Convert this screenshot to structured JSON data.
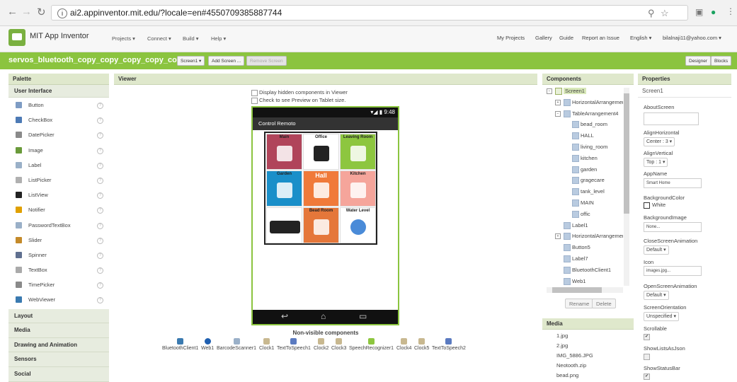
{
  "browser": {
    "url": "ai2.appinventor.mit.edu/?locale=en#4550709385887744"
  },
  "topbar": {
    "brand": "MIT App Inventor",
    "menus": [
      "Projects ▾",
      "Connect ▾",
      "Build ▾",
      "Help ▾"
    ],
    "right_links": [
      "My Projects",
      "Gallery",
      "Guide",
      "Report an Issue",
      "English ▾",
      "bilalnaji11@yahoo.com ▾"
    ]
  },
  "projectbar": {
    "name": "servos_bluetooth_copy_copy_copy_copy_copy",
    "screen_select": "Screen1 ▾",
    "add_screen": "Add Screen ...",
    "remove_screen": "Remove Screen",
    "designer": "Designer",
    "blocks": "Blocks"
  },
  "palette": {
    "title": "Palette",
    "category_open": "User Interface",
    "items": [
      "Button",
      "CheckBox",
      "DatePicker",
      "Image",
      "Label",
      "ListPicker",
      "ListView",
      "Notifier",
      "PasswordTextBox",
      "Slider",
      "Spinner",
      "TextBox",
      "TimePicker",
      "WebViewer"
    ],
    "other_categories": [
      "Layout",
      "Media",
      "Drawing and Animation",
      "Sensors",
      "Social"
    ]
  },
  "viewer": {
    "title": "Viewer",
    "check_hidden": "Display hidden components in Viewer",
    "check_tablet": "Check to see Preview on Tablet size.",
    "status_time": "9:48",
    "app_title": "Control Remoto",
    "tiles": [
      {
        "label": "Main",
        "color": "#b0445a"
      },
      {
        "label": "Office",
        "color": "#ffffff"
      },
      {
        "label": "Leaving Room",
        "color": "#8dc63f"
      },
      {
        "label": "Garden",
        "color": "#1a8fc9"
      },
      {
        "label": "Hall",
        "color": "#f07a3a"
      },
      {
        "label": "Kitchen",
        "color": "#f5a59b"
      },
      {
        "label": "",
        "color": "#ffffff"
      },
      {
        "label": "Bead Room",
        "color": "#e5773a"
      },
      {
        "label": "Water Level",
        "color": "#ffffff"
      }
    ],
    "nonvisible_title": "Non-visible components",
    "nonvisible": [
      "BluetoothClient1",
      "Web1",
      "BarcodeScanner1",
      "Clock1",
      "TextToSpeech1",
      "Clock2",
      "Clock3",
      "SpeechRecognizer1",
      "Clock4",
      "Clock5",
      "TextToSpeech2"
    ]
  },
  "components": {
    "title": "Components",
    "tree": [
      {
        "name": "Screen1",
        "level": 0,
        "toggle": "⊟"
      },
      {
        "name": "HorizontalArrangement",
        "level": 1,
        "toggle": "⊞"
      },
      {
        "name": "TableArrangement4",
        "level": 1,
        "toggle": "⊟"
      },
      {
        "name": "bead_room",
        "level": 2,
        "toggle": ""
      },
      {
        "name": "HALL",
        "level": 2,
        "toggle": ""
      },
      {
        "name": "living_room",
        "level": 2,
        "toggle": ""
      },
      {
        "name": "kitchen",
        "level": 2,
        "toggle": ""
      },
      {
        "name": "garden",
        "level": 2,
        "toggle": ""
      },
      {
        "name": "gragecare",
        "level": 2,
        "toggle": ""
      },
      {
        "name": "tank_level",
        "level": 2,
        "toggle": ""
      },
      {
        "name": "MAIN",
        "level": 2,
        "toggle": ""
      },
      {
        "name": "offic",
        "level": 2,
        "toggle": ""
      },
      {
        "name": "Label1",
        "level": 1,
        "toggle": ""
      },
      {
        "name": "HorizontalArrangement",
        "level": 1,
        "toggle": "⊞"
      },
      {
        "name": "Button5",
        "level": 1,
        "toggle": ""
      },
      {
        "name": "Label7",
        "level": 1,
        "toggle": ""
      },
      {
        "name": "BluetoothClient1",
        "level": 1,
        "toggle": ""
      },
      {
        "name": "Web1",
        "level": 1,
        "toggle": ""
      }
    ],
    "rename": "Rename",
    "delete": "Delete"
  },
  "media": {
    "title": "Media",
    "files": [
      "1.jpg",
      "2.jpg",
      "IMG_5886.JPG",
      "Neotooth.zip",
      "bead.png"
    ]
  },
  "properties": {
    "title": "Properties",
    "component": "Screen1",
    "about_screen_label": "AboutScreen",
    "align_h_label": "AlignHorizontal",
    "align_h_value": "Center : 3 ▾",
    "align_v_label": "AlignVertical",
    "align_v_value": "Top : 1 ▾",
    "app_name_label": "AppName",
    "app_name_value": "Smart Home",
    "bg_color_label": "BackgroundColor",
    "bg_color_value": "White",
    "bg_image_label": "BackgroundImage",
    "bg_image_value": "None...",
    "close_anim_label": "CloseScreenAnimation",
    "close_anim_value": "Default ▾",
    "icon_label": "Icon",
    "icon_value": "images.jpg...",
    "open_anim_label": "OpenScreenAnimation",
    "open_anim_value": "Default ▾",
    "orientation_label": "ScreenOrientation",
    "orientation_value": "Unspecified ▾",
    "scrollable_label": "Scrollable",
    "show_lists_label": "ShowListsAsJson",
    "show_status_label": "ShowStatusBar"
  }
}
